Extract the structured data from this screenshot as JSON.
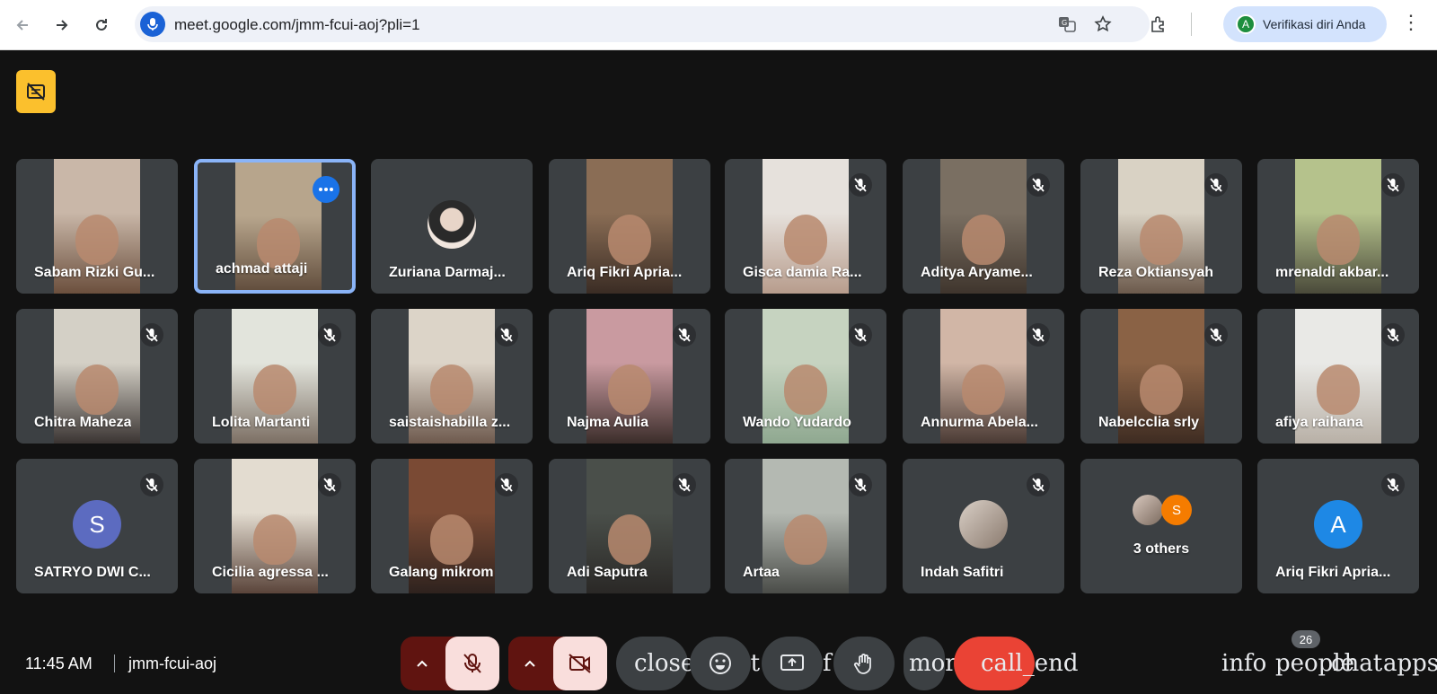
{
  "browser": {
    "url": "meet.google.com/jmm-fcui-aoj?pli=1",
    "profile_label": "Verifikasi diri Anda",
    "profile_initial": "A"
  },
  "tiles": [
    {
      "name": "Sabam Rizki Gu...",
      "muted": false
    },
    {
      "name": "achmad attaji",
      "muted": false,
      "selected": true
    },
    {
      "name": "Zuriana Darmaj...",
      "muted": false
    },
    {
      "name": "Ariq Fikri Apria...",
      "muted": false
    },
    {
      "name": "Gisca damia Ra...",
      "muted": true
    },
    {
      "name": "Aditya Aryame...",
      "muted": true
    },
    {
      "name": "Reza Oktiansyah",
      "muted": true
    },
    {
      "name": "mrenaldi akbar...",
      "muted": true
    },
    {
      "name": "Chitra Maheza",
      "muted": true
    },
    {
      "name": "Lolita Martanti",
      "muted": true
    },
    {
      "name": "saistaishabilla z...",
      "muted": true
    },
    {
      "name": "Najma Aulia",
      "muted": true
    },
    {
      "name": "Wando Yudardo",
      "muted": true
    },
    {
      "name": "Annurma Abela...",
      "muted": true
    },
    {
      "name": "Nabelcclia srly",
      "muted": true
    },
    {
      "name": "afiya raihana",
      "muted": true
    },
    {
      "name": "SATRYO DWI C...",
      "muted": true,
      "initial": "S"
    },
    {
      "name": "Cicilia agressa ...",
      "muted": true
    },
    {
      "name": "Galang mikrom",
      "muted": true
    },
    {
      "name": "Adi Saputra",
      "muted": true
    },
    {
      "name": "Artaa",
      "muted": true
    },
    {
      "name": "Indah Safitri",
      "muted": true
    },
    {
      "name": "3 others",
      "muted": false,
      "others_initial": "S"
    },
    {
      "name": "Ariq Fikri Apria...",
      "muted": true,
      "initial": "A"
    }
  ],
  "meeting": {
    "time": "11:45 AM",
    "code": "jmm-fcui-aoj"
  },
  "controls": {
    "captions_text": "close",
    "captions_tail": "ot",
    "reactions_tail": "f",
    "more_text": "mor",
    "end_call_text": "call_end",
    "info_text": "info",
    "people_text": "people",
    "chat_text": "chat",
    "apps_text": "apps",
    "people_count": "26"
  },
  "colors": {
    "accent_blue": "#1a73e8",
    "end_call_red": "#ea4335",
    "muted_control_bg": "#f9dedc",
    "dark_red": "#601410",
    "badge_yellow": "#fbc02d"
  }
}
